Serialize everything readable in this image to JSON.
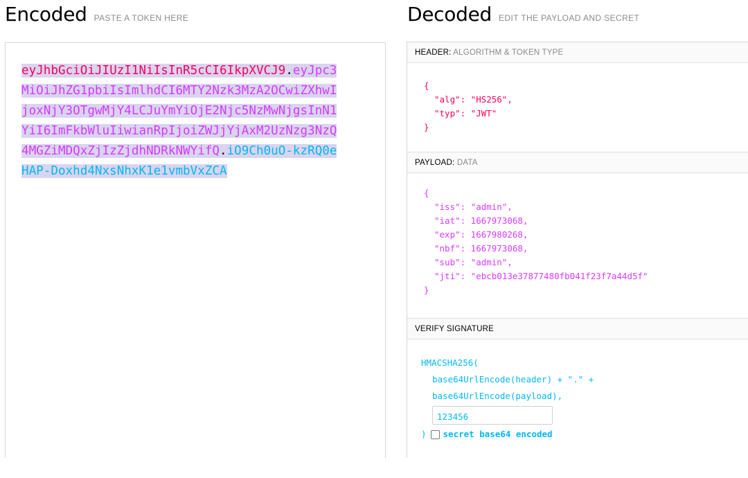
{
  "encoded": {
    "title": "Encoded",
    "subtitle": "PASTE A TOKEN HERE",
    "token": {
      "header": "eyJhbGciOiJIUzI1NiIsInR5cCI6IkpXVCJ9",
      "payload": "eyJpc3MiOiJhZG1pbiIsImlhdCI6MTY2Nzk3MzA2OCwiZXhwIjoxNjY3OTgwMjY4LCJuYmYiOjE2Njc5NzMwNjgsInN1YiI6ImFkbWluIiwianRpIjoiZWJjYjAxM2UzNzg3NzQ4MGZiMDQxZjIzZjdhNDRkNWYifQ",
      "signature": "iO9Ch0uO-kzRQ0eHAP-Doxhd4NxsNhxK1e1vmbVxZCA",
      "dot": "."
    }
  },
  "decoded": {
    "title": "Decoded",
    "subtitle": "EDIT THE PAYLOAD AND SECRET",
    "header_section": {
      "label": "HEADER:",
      "sublabel": "ALGORITHM & TOKEN TYPE",
      "open": "{",
      "lines": [
        "\"alg\": \"HS256\",",
        "\"typ\": \"JWT\""
      ],
      "close": "}"
    },
    "payload_section": {
      "label": "PAYLOAD:",
      "sublabel": "DATA",
      "open": "{",
      "lines": [
        "\"iss\": \"admin\",",
        "\"iat\": 1667973068,",
        "\"exp\": 1667980268,",
        "\"nbf\": 1667973068,",
        "\"sub\": \"admin\",",
        "\"jti\": \"ebcb013e37877480fb041f23f7a44d5f\""
      ],
      "close": "}"
    },
    "signature_section": {
      "label": "VERIFY SIGNATURE",
      "fn": "HMACSHA256(",
      "line1": "base64UrlEncode(header) + \".\" +",
      "line2": "base64UrlEncode(payload),",
      "secret_value": "123456",
      "close": ")",
      "checkbox_label": "secret base64 encoded"
    }
  },
  "colors": {
    "header": "#fb015b",
    "payload": "#d63aff",
    "signature": "#00b9f1",
    "selection": "#d9d4f0"
  }
}
